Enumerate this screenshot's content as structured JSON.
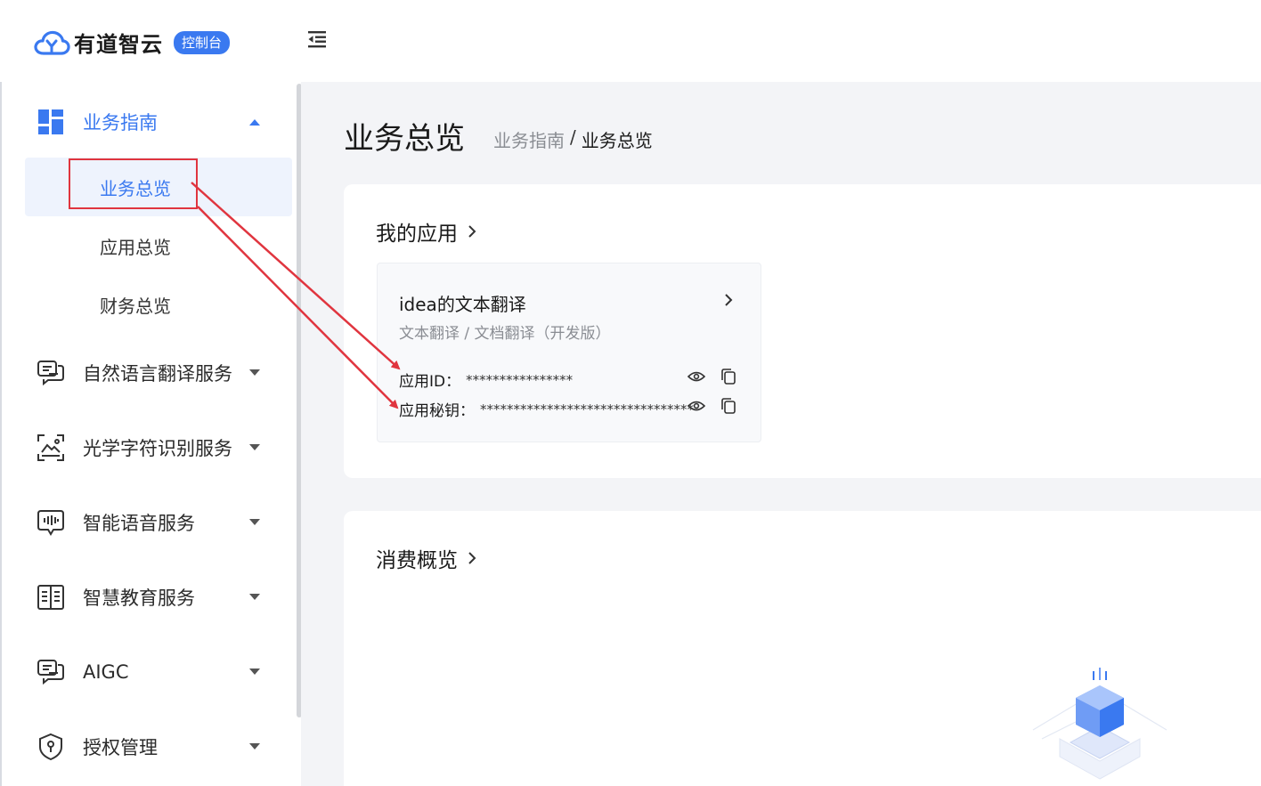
{
  "header": {
    "logo_text": "有道智云",
    "badge": "控制台"
  },
  "sidebar": {
    "groups": [
      {
        "label": "业务指南",
        "icon": "dashboard-grid-icon",
        "expanded": true
      },
      {
        "label": "自然语言翻译服务",
        "icon": "translate-chat-icon"
      },
      {
        "label": "光学字符识别服务",
        "icon": "image-scan-icon"
      },
      {
        "label": "智能语音服务",
        "icon": "voice-wave-icon"
      },
      {
        "label": "智慧教育服务",
        "icon": "open-book-icon"
      },
      {
        "label": "AIGC",
        "icon": "chat-stack-icon"
      },
      {
        "label": "授权管理",
        "icon": "shield-key-icon"
      }
    ],
    "sub_items": [
      {
        "label": "业务总览",
        "active": true
      },
      {
        "label": "应用总览"
      },
      {
        "label": "财务总览"
      }
    ]
  },
  "main": {
    "title": "业务总览",
    "breadcrumb": {
      "parent": "业务指南",
      "separator": "/",
      "current": "业务总览"
    },
    "my_apps": {
      "title": "我的应用",
      "app": {
        "name": "idea的文本翻译",
        "types": "文本翻译 / 文档翻译（开发版）",
        "id_label": "应用ID：",
        "id_value": "****************",
        "secret_label": "应用秘钥：",
        "secret_value": "********************************"
      }
    },
    "consumption": {
      "title": "消费概览"
    }
  },
  "colors": {
    "accent": "#3a79f0",
    "annotation_red": "#e0353f",
    "main_bg": "#f3f4f7"
  }
}
